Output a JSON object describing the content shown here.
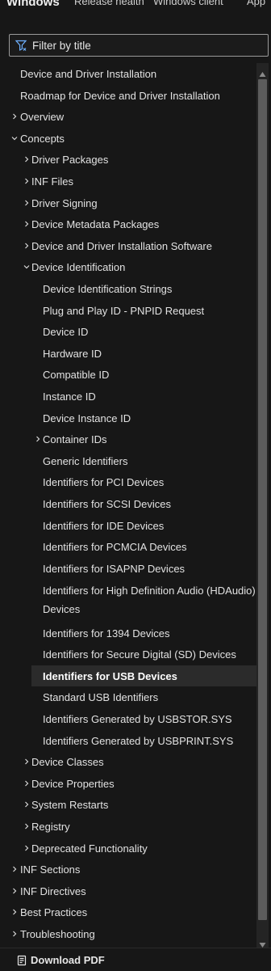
{
  "header": {
    "brand": "Windows",
    "links": [
      "Release health",
      "Windows client",
      "App"
    ]
  },
  "filter": {
    "placeholder": "Filter by title",
    "value": ""
  },
  "tree": [
    {
      "label": "Device and Driver Installation",
      "level": 0,
      "expander": "none"
    },
    {
      "label": "Roadmap for Device and Driver Installation",
      "level": 0,
      "expander": "none"
    },
    {
      "label": "Overview",
      "level": 0,
      "expander": "collapsed"
    },
    {
      "label": "Concepts",
      "level": 0,
      "expander": "expanded"
    },
    {
      "label": "Driver Packages",
      "level": 1,
      "expander": "collapsed"
    },
    {
      "label": "INF Files",
      "level": 1,
      "expander": "collapsed"
    },
    {
      "label": "Driver Signing",
      "level": 1,
      "expander": "collapsed"
    },
    {
      "label": "Device Metadata Packages",
      "level": 1,
      "expander": "collapsed"
    },
    {
      "label": "Device and Driver Installation Software",
      "level": 1,
      "expander": "collapsed"
    },
    {
      "label": "Device Identification",
      "level": 1,
      "expander": "expanded"
    },
    {
      "label": "Device Identification Strings",
      "level": 2,
      "expander": "none"
    },
    {
      "label": "Plug and Play ID - PNPID Request",
      "level": 2,
      "expander": "none"
    },
    {
      "label": "Device ID",
      "level": 2,
      "expander": "none"
    },
    {
      "label": "Hardware ID",
      "level": 2,
      "expander": "none"
    },
    {
      "label": "Compatible ID",
      "level": 2,
      "expander": "none"
    },
    {
      "label": "Instance ID",
      "level": 2,
      "expander": "none"
    },
    {
      "label": "Device Instance ID",
      "level": 2,
      "expander": "none"
    },
    {
      "label": "Container IDs",
      "level": 2,
      "expander": "collapsed"
    },
    {
      "label": "Generic Identifiers",
      "level": 2,
      "expander": "none"
    },
    {
      "label": "Identifiers for PCI Devices",
      "level": 2,
      "expander": "none"
    },
    {
      "label": "Identifiers for SCSI Devices",
      "level": 2,
      "expander": "none"
    },
    {
      "label": "Identifiers for IDE Devices",
      "level": 2,
      "expander": "none"
    },
    {
      "label": "Identifiers for PCMCIA Devices",
      "level": 2,
      "expander": "none"
    },
    {
      "label": "Identifiers for ISAPNP Devices",
      "level": 2,
      "expander": "none"
    },
    {
      "label": "Identifiers for High Definition Audio (HDAudio) Devices",
      "level": 2,
      "expander": "none",
      "wrap": true
    },
    {
      "label": "Identifiers for 1394 Devices",
      "level": 2,
      "expander": "none"
    },
    {
      "label": "Identifiers for Secure Digital (SD) Devices",
      "level": 2,
      "expander": "none"
    },
    {
      "label": "Identifiers for USB Devices",
      "level": 2,
      "expander": "none",
      "selected": true
    },
    {
      "label": "Standard USB Identifiers",
      "level": 2,
      "expander": "none"
    },
    {
      "label": "Identifiers Generated by USBSTOR.SYS",
      "level": 2,
      "expander": "none"
    },
    {
      "label": "Identifiers Generated by USBPRINT.SYS",
      "level": 2,
      "expander": "none"
    },
    {
      "label": "Device Classes",
      "level": 1,
      "expander": "collapsed"
    },
    {
      "label": "Device Properties",
      "level": 1,
      "expander": "collapsed"
    },
    {
      "label": "System Restarts",
      "level": 1,
      "expander": "collapsed"
    },
    {
      "label": "Registry",
      "level": 1,
      "expander": "collapsed"
    },
    {
      "label": "Deprecated Functionality",
      "level": 1,
      "expander": "collapsed"
    },
    {
      "label": "INF Sections",
      "level": 0,
      "expander": "collapsed"
    },
    {
      "label": "INF Directives",
      "level": 0,
      "expander": "collapsed"
    },
    {
      "label": "Best Practices",
      "level": 0,
      "expander": "collapsed"
    },
    {
      "label": "Troubleshooting",
      "level": 0,
      "expander": "collapsed"
    }
  ],
  "footer": {
    "download_label": "Download PDF"
  },
  "colors": {
    "background": "#171717",
    "selected_row": "#2b2b2b",
    "scrollbar_thumb": "#5c5c5c"
  },
  "icons": {
    "filter": "filter-icon",
    "download": "pdf-file-icon"
  }
}
